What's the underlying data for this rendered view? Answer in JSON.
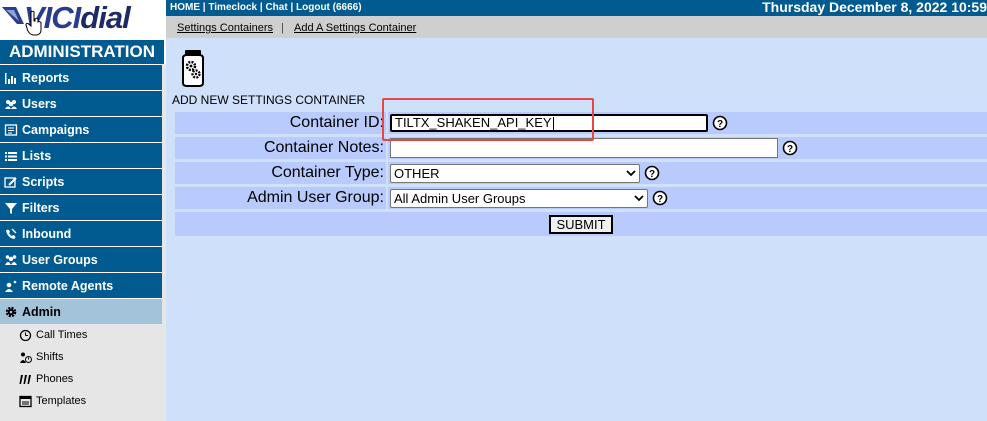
{
  "logo": {
    "brand_a": "VICI",
    "brand_b": "dial"
  },
  "sidebar": {
    "title": "ADMINISTRATION",
    "items": [
      {
        "label": "Reports",
        "icon": "reports-icon"
      },
      {
        "label": "Users",
        "icon": "users-icon"
      },
      {
        "label": "Campaigns",
        "icon": "campaigns-icon"
      },
      {
        "label": "Lists",
        "icon": "lists-icon"
      },
      {
        "label": "Scripts",
        "icon": "scripts-icon"
      },
      {
        "label": "Filters",
        "icon": "filters-icon"
      },
      {
        "label": "Inbound",
        "icon": "inbound-icon"
      },
      {
        "label": "User Groups",
        "icon": "user-groups-icon"
      },
      {
        "label": "Remote Agents",
        "icon": "remote-agents-icon"
      },
      {
        "label": "Admin",
        "icon": "gear-icon",
        "selected": true
      }
    ],
    "subitems": [
      {
        "label": "Call Times",
        "icon": "clock-icon"
      },
      {
        "label": "Shifts",
        "icon": "shifts-icon"
      },
      {
        "label": "Phones",
        "icon": "phones-icon"
      },
      {
        "label": "Templates",
        "icon": "templates-icon"
      }
    ]
  },
  "topbar": {
    "links": "HOME | Timeclock | Chat | Logout (6666)",
    "date": "Thursday December 8, 2022 10:59"
  },
  "subbar": {
    "link1": "Settings Containers",
    "separator": "|",
    "link2": "Add A Settings Container"
  },
  "form": {
    "section_title": "ADD NEW SETTINGS CONTAINER",
    "container_id_label": "Container ID:",
    "container_id_value": "TILTX_SHAKEN_API_KEY",
    "notes_label": "Container Notes:",
    "notes_value": "",
    "type_label": "Container Type:",
    "type_value": "OTHER",
    "group_label": "Admin User Group:",
    "group_value": "All Admin User Groups",
    "submit_label": "SUBMIT"
  },
  "colors": {
    "nav_bg": "#015b91",
    "nav_selected": "#a3c3d9",
    "page_bg": "#cfe0fa",
    "row_bg": "#b9cbfd",
    "highlight": "#e34848"
  }
}
